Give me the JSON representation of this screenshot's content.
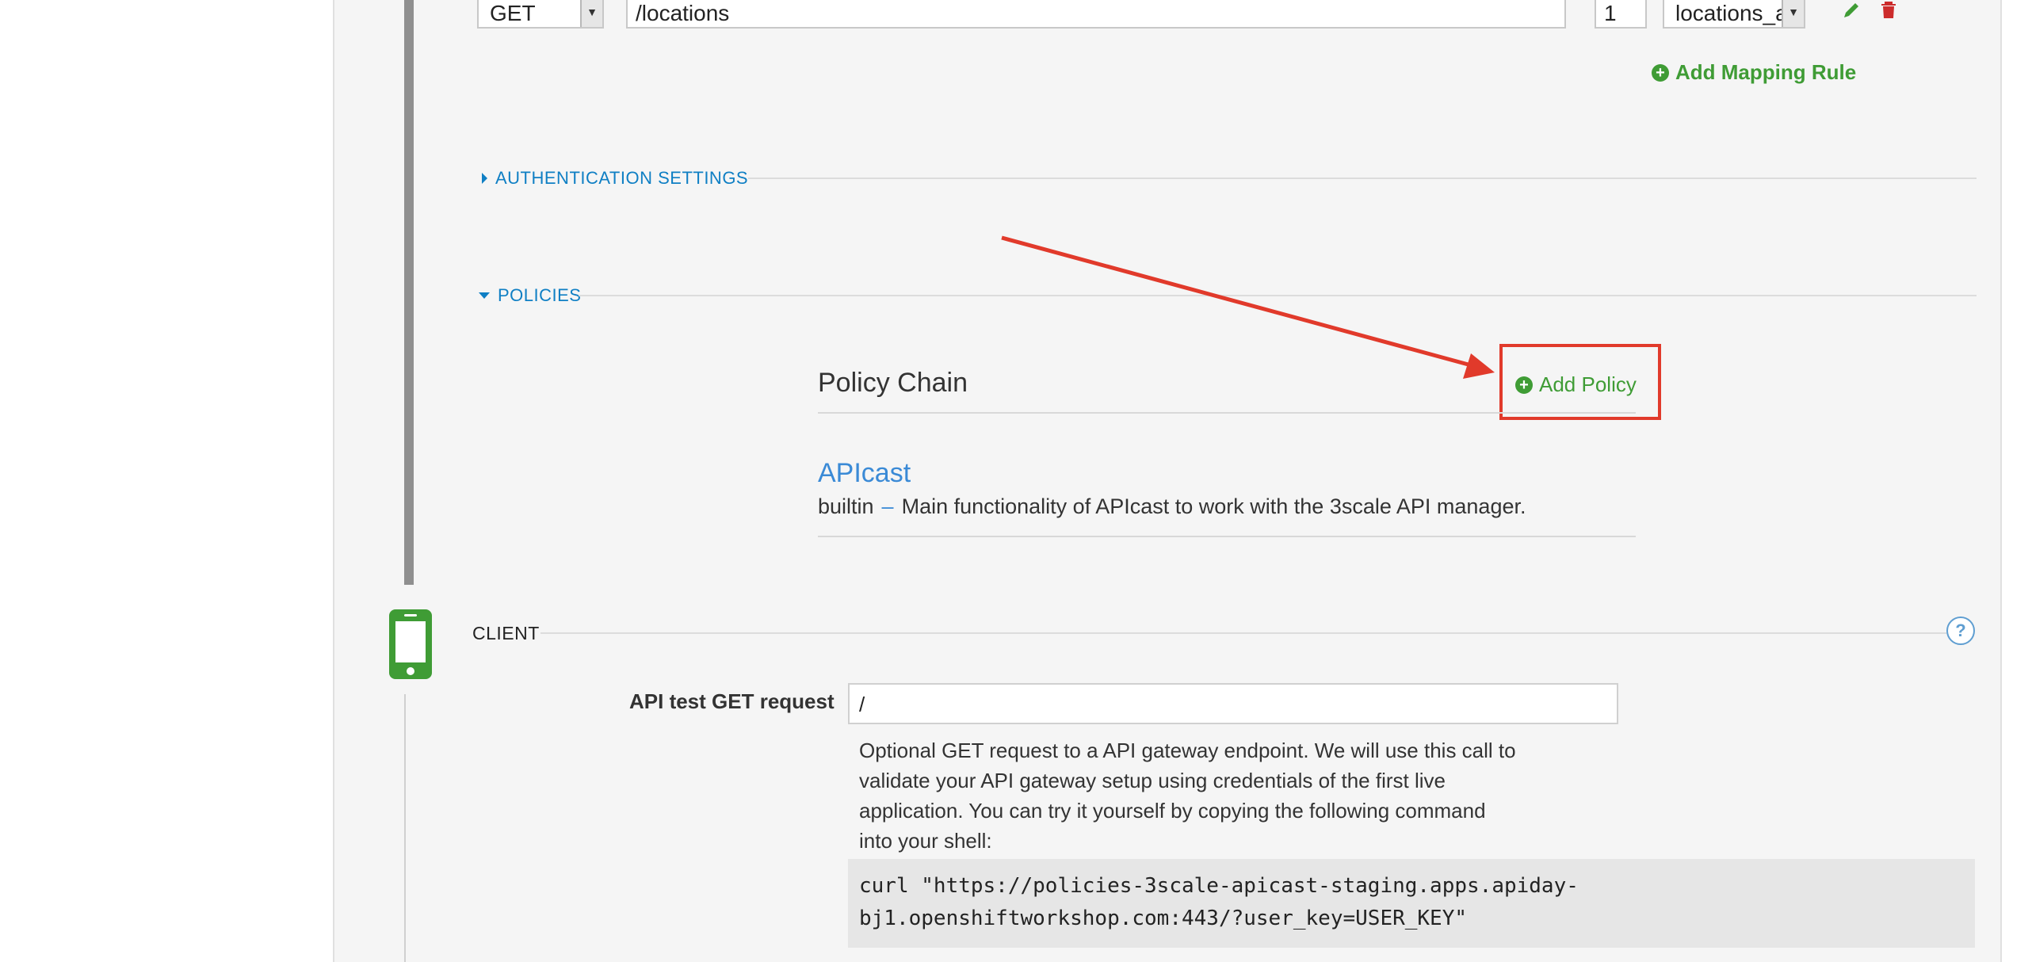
{
  "mapping_row": {
    "method": "GET",
    "pattern": "/locations",
    "delta": "1",
    "metric": "locations_a"
  },
  "add_mapping_rule_label": "Add Mapping Rule",
  "sections": {
    "authentication": "AUTHENTICATION SETTINGS",
    "policies": "POLICIES",
    "client": "CLIENT"
  },
  "policy_chain": {
    "title": "Policy Chain",
    "add_policy_label": "Add Policy",
    "policies": [
      {
        "name": "APIcast",
        "type": "builtin",
        "separator": "–",
        "description": "Main functionality of APIcast to work with the 3scale API manager."
      }
    ]
  },
  "client": {
    "api_test_label": "API test GET request",
    "api_test_value": "/",
    "help_line1": "Optional GET request to a API gateway endpoint. We will use this call to",
    "help_line2": "validate your API gateway setup using credentials of the first live",
    "help_line3": "application. You can try it yourself by copying the following command",
    "help_line4": "into your shell:",
    "curl_line1": "curl \"https://policies-3scale-apicast-staging.apps.apiday-",
    "curl_line2": "bj1.openshiftworkshop.com:443/?user_key=USER_KEY\"",
    "help_icon": "?"
  },
  "icons": {
    "edit": "pencil-icon",
    "delete": "trash-icon",
    "device": "mobile-phone-icon"
  },
  "colors": {
    "link_blue": "#0f7fc4",
    "action_green": "#3f9c35",
    "annotation_red": "#e13a2b"
  }
}
